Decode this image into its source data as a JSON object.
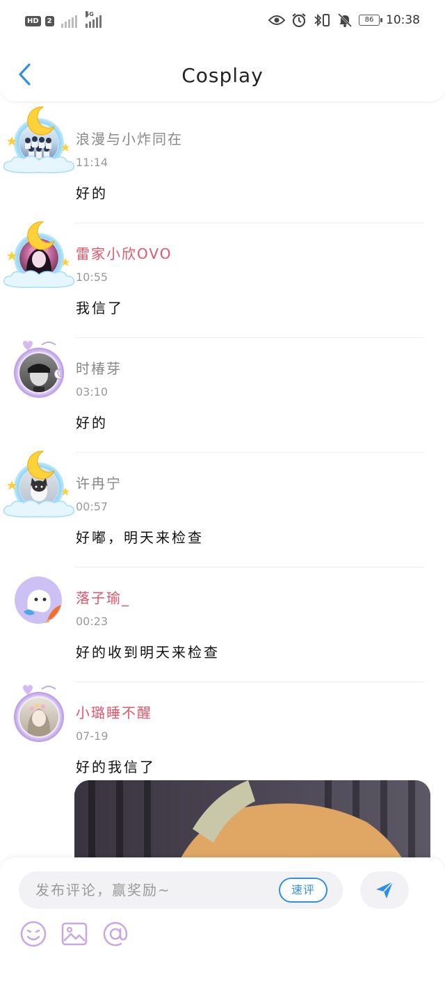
{
  "status_bar": {
    "hd": "HD",
    "sim_slot": "2",
    "network": "5G",
    "battery": "86",
    "time": "10:38"
  },
  "header": {
    "title": "Cosplay"
  },
  "comments": [
    {
      "name": "浪漫与小炸同在",
      "time": "11:14",
      "text": "好的",
      "name_color": "#888888"
    },
    {
      "name": "雷家小欣OVO",
      "time": "10:55",
      "text": "我信了",
      "name_color": "#e0566a"
    },
    {
      "name": "时椿芽",
      "time": "03:10",
      "text": "好的",
      "name_color": "#888888"
    },
    {
      "name": "许冉宁",
      "time": "00:57",
      "text": "好嘟，明天来检查",
      "name_color": "#888888"
    },
    {
      "name": "落子瑜_",
      "time": "00:23",
      "text": "好的收到明天来检查",
      "name_color": "#e0566a"
    },
    {
      "name": "小璐睡不醒",
      "time": "07-19",
      "text": "好的我信了",
      "name_color": "#e0566a"
    }
  ],
  "composer": {
    "placeholder": "发布评论，赢奖励~",
    "quick_label": "速评"
  },
  "colors": {
    "accent": "#2e8fe8",
    "pink_name": "#e0566a",
    "tool_icon": "#c7a6e8"
  },
  "icons": {
    "back": "chevron-left-icon",
    "send": "send-icon",
    "emoji": "emoji-icon",
    "image": "image-icon",
    "mention": "at-icon"
  }
}
